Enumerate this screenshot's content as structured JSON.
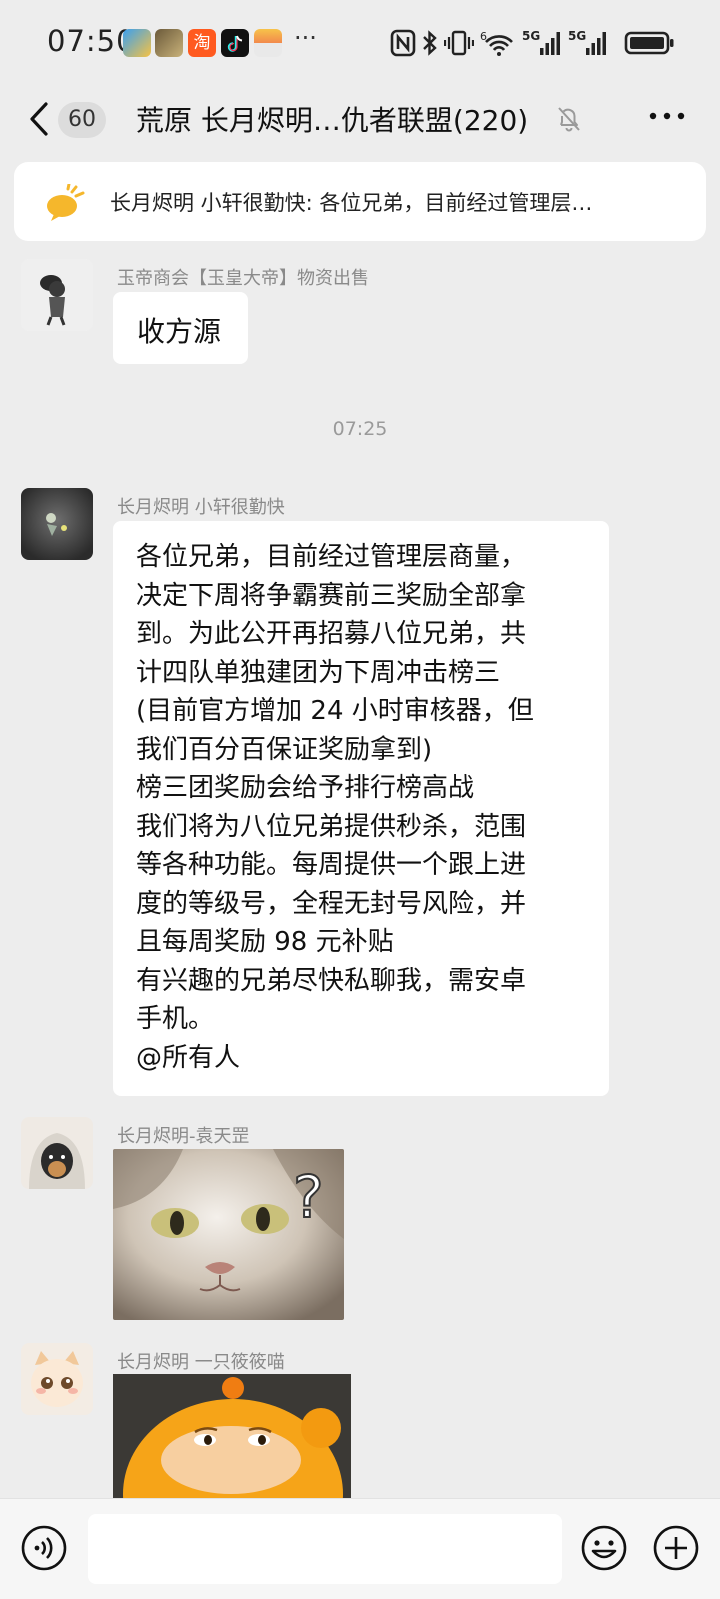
{
  "status_bar": {
    "time": "07:50",
    "more": "···",
    "app_icons": [
      "weather-icon",
      "game-icon",
      "taobao-icon",
      "tiktok-icon",
      "wallet-icon"
    ],
    "system_icons": [
      "nfc-icon",
      "bluetooth-icon",
      "vibrate-icon",
      "wifi-icon",
      "signal-5g-icon",
      "signal-5g-icon",
      "battery-icon"
    ],
    "network_label": "5G",
    "wifi_label": "6"
  },
  "header": {
    "back_label": "60",
    "title": "荒原  长月烬明…仇者联盟(220)",
    "muted": true
  },
  "announcement": {
    "text": "长月烬明 小轩很勤快: 各位兄弟，目前经过管理层…"
  },
  "messages": [
    {
      "sender": "玉帝商会【玉皇大帝】物资出售",
      "type": "text",
      "text": "收方源"
    },
    {
      "type": "timestamp",
      "text": "07:25"
    },
    {
      "sender": "长月烬明 小轩很勤快",
      "type": "text",
      "text": "各位兄弟，目前经过管理层商量，\n决定下周将争霸赛前三奖励全部拿\n到。为此公开再招募八位兄弟，共\n计四队单独建团为下周冲击榜三\n(目前官方增加 24 小时审核器，但\n我们百分百保证奖励拿到)\n榜三团奖励会给予排行榜高战\n我们将为八位兄弟提供秒杀，范围\n等各种功能。每周提供一个跟上进\n度的等级号，全程无封号风险，并\n且每周奖励 98 元补贴\n有兴趣的兄弟尽快私聊我，需安卓\n手机。\n@所有人"
    },
    {
      "sender": "长月烬明-袁天罡",
      "type": "sticker",
      "sticker": "cat-question-sticker",
      "sticker_text": "?"
    },
    {
      "sender": "长月烬明  一只筱筱喵",
      "type": "sticker",
      "sticker": "orange-creature-sticker"
    }
  ],
  "input_bar": {
    "placeholder": "",
    "icons": [
      "voice-icon",
      "emoji-icon",
      "plus-icon"
    ]
  },
  "colors": {
    "background": "#ededed",
    "bubble": "#ffffff",
    "sender_text": "#8a8a8a",
    "announce_icon": "#f5b72c"
  }
}
